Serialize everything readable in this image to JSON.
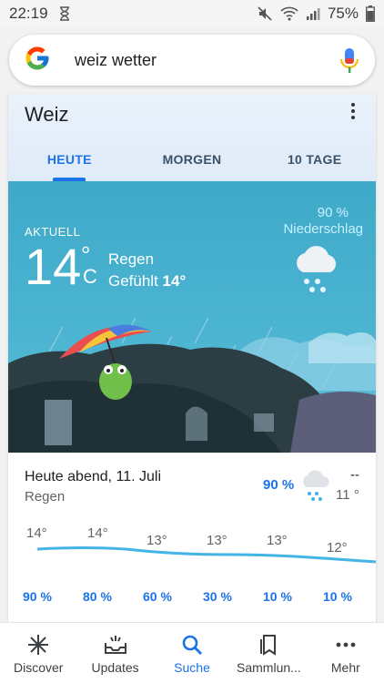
{
  "statusbar": {
    "time": "22:19",
    "battery": "75%",
    "icons": [
      "hourglass-icon",
      "mute-icon",
      "wifi-icon",
      "signal-icon",
      "battery-icon"
    ]
  },
  "search": {
    "query": "weiz wetter",
    "icons": [
      "google-logo-icon",
      "microphone-icon"
    ]
  },
  "weather": {
    "place": "Weiz",
    "tabs": [
      {
        "label": "HEUTE",
        "active": true
      },
      {
        "label": "MORGEN",
        "active": false
      },
      {
        "label": "10 TAGE",
        "active": false
      }
    ],
    "current": {
      "label": "AKTUELL",
      "temperature": "14",
      "degree": "°",
      "unit": "C",
      "condition": "Regen",
      "feels_prefix": "Gefühlt",
      "feels_value": "14°",
      "precip_percent": "90 %",
      "precip_label": "Niederschlag"
    },
    "forecast": {
      "title": "Heute abend, 11. Juli",
      "condition": "Regen",
      "precip": "90 %",
      "high": "--",
      "low": "11 °"
    },
    "hourly": {
      "temps": [
        "14°",
        "14°",
        "13°",
        "13°",
        "13°",
        "12°"
      ],
      "precip": [
        "90 %",
        "80 %",
        "60 %",
        "30 %",
        "10 %",
        "10 %"
      ]
    },
    "colors": {
      "accent": "#1a73e8",
      "sky": "#4bb4d1",
      "precip_text": "#c8f1ff"
    }
  },
  "bottomnav": {
    "items": [
      {
        "label": "Discover",
        "icon": "asterisk-icon"
      },
      {
        "label": "Updates",
        "icon": "inbox-icon"
      },
      {
        "label": "Suche",
        "icon": "search-icon",
        "active": true
      },
      {
        "label": "Sammlun...",
        "icon": "bookmarks-icon"
      },
      {
        "label": "Mehr",
        "icon": "more-icon"
      }
    ]
  }
}
